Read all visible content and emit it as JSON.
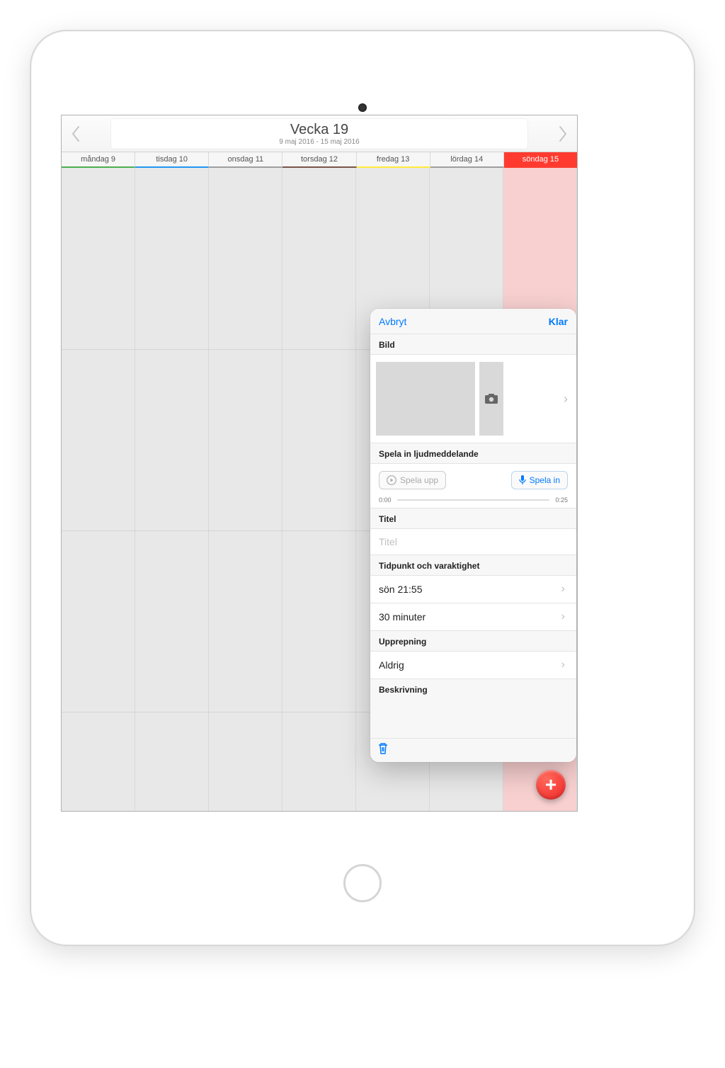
{
  "header": {
    "title": "Vecka 19",
    "subtitle": "9 maj 2016 - 15 maj 2016"
  },
  "days": [
    {
      "label": "måndag 9",
      "color": "#4caf50",
      "today": false
    },
    {
      "label": "tisdag 10",
      "color": "#2196f3",
      "today": false
    },
    {
      "label": "onsdag 11",
      "color": "#9e9e9e",
      "today": false
    },
    {
      "label": "torsdag 12",
      "color": "#795548",
      "today": false
    },
    {
      "label": "fredag 13",
      "color": "#ffeb3b",
      "today": false
    },
    {
      "label": "lördag 14",
      "color": "#9e9e9e",
      "today": false
    },
    {
      "label": "söndag 15",
      "color": "#ff3b30",
      "today": true
    }
  ],
  "popover": {
    "cancel": "Avbryt",
    "done": "Klar",
    "image_label": "Bild",
    "audio_label": "Spela in ljudmeddelande",
    "play_label": "Spela upp",
    "record_label": "Spela in",
    "track_start": "0:00",
    "track_end": "0:25",
    "title_label": "Titel",
    "title_placeholder": "Titel",
    "timing_label": "Tidpunkt och varaktighet",
    "datetime": "sön 21:55",
    "duration": "30 minuter",
    "repeat_label": "Upprepning",
    "repeat_value": "Aldrig",
    "description_label": "Beskrivning"
  }
}
